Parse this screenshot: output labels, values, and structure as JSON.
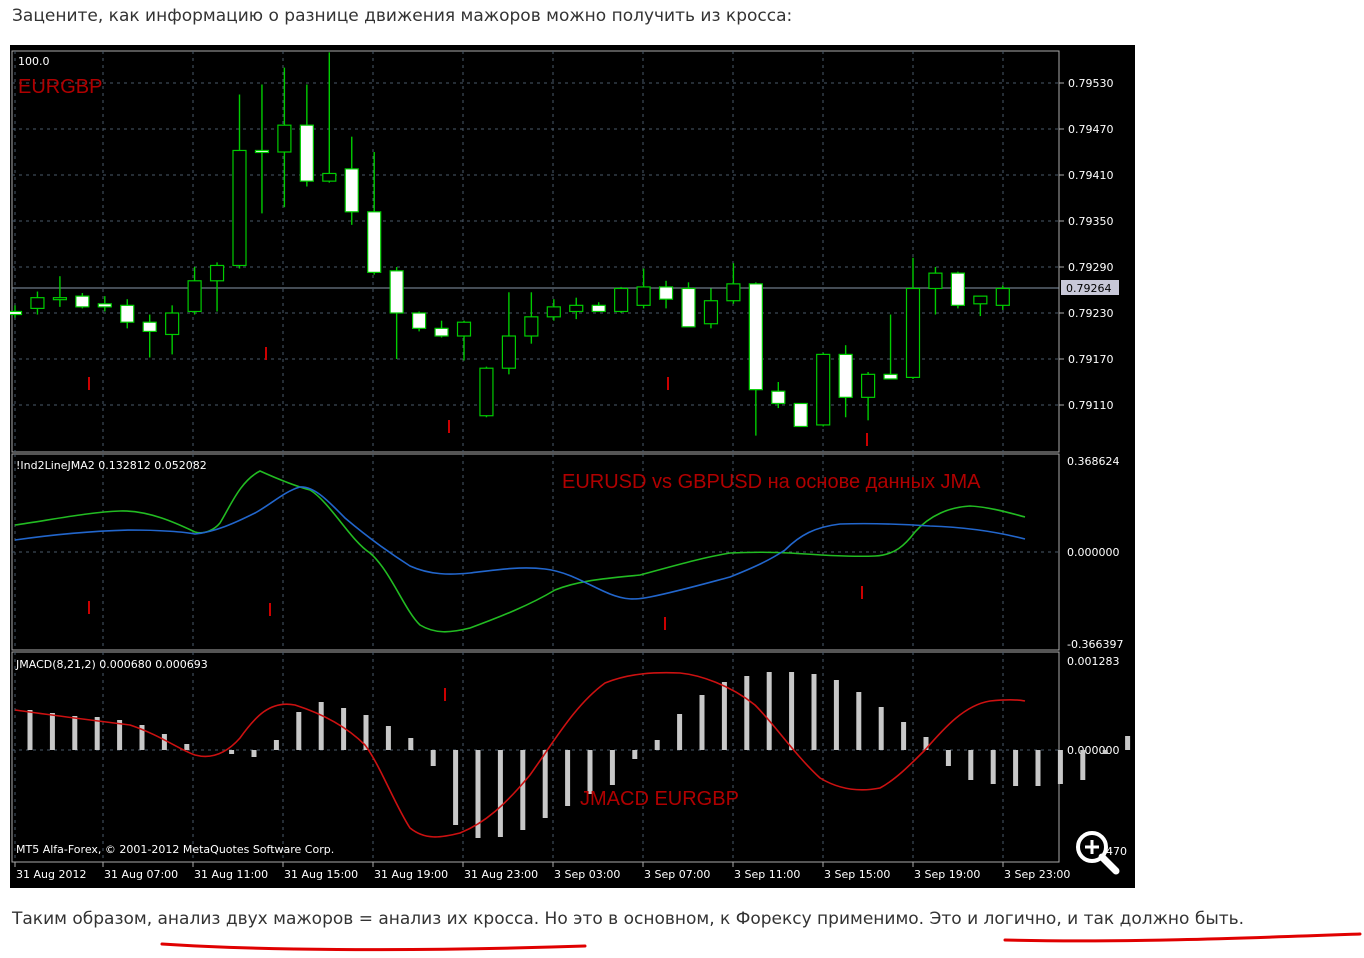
{
  "intro_text": "Зацените, как информацию о разнице движения мажоров можно получить из кросса:",
  "outro": {
    "part1": "Таким образом, ",
    "part2": "анализ двух мажоров = анализ их кросса.",
    "part3": " Но это в основном, к Форексу применимо. ",
    "part4": "Это и логично, и так должно быть."
  },
  "colors": {
    "background": "#000000",
    "grid": "#4a5a6a",
    "bull": "#00cc00",
    "bear_fill": "#ffffff",
    "jma_green": "#22bb22",
    "jma_blue": "#2266cc",
    "signal_red": "#cc0000",
    "histogram": "#c8c8c8",
    "underline": "#e00000"
  },
  "main_panel": {
    "top_label": "100.0",
    "symbol": "EURGBP",
    "price_ticks": [
      "0.79530",
      "0.79470",
      "0.79410",
      "0.79350",
      "0.79290",
      "0.79230",
      "0.79170",
      "0.79110"
    ],
    "price_tick_values": [
      0.7953,
      0.7947,
      0.7941,
      0.7935,
      0.7929,
      0.7923,
      0.7917,
      0.7911
    ],
    "current_price": "0.79264",
    "current_price_value": 0.79264
  },
  "indicator_panel": {
    "title": "!Ind2LineJMA2 0.132812 0.052082",
    "annotation": "EURUSD vs GBPUSD на основе данных JMA",
    "ticks": [
      "0.368624",
      "0.000000",
      "-0.366397"
    ]
  },
  "jmacd_panel": {
    "title": "JMACD(8,21,2) 0.000680 0.000693",
    "annotation": "JMACD EURGBP",
    "ticks": [
      "0.001283",
      "0.000000",
      "470"
    ],
    "copyright": "MT5 Alfa-Forex, © 2001-2012 MetaQuotes Software Corp."
  },
  "time_axis": [
    "31 Aug 2012",
    "31 Aug 07:00",
    "31 Aug 11:00",
    "31 Aug 15:00",
    "31 Aug 19:00",
    "31 Aug 23:00",
    "3 Sep 03:00",
    "3 Sep 07:00",
    "3 Sep 11:00",
    "3 Sep 15:00",
    "3 Sep 19:00",
    "3 Sep 23:00"
  ],
  "zoom_icon": "magnifier-plus-icon",
  "chart_data": {
    "type": "candlestick",
    "title": "EURGBP",
    "candles": [
      {
        "o": 0.79232,
        "h": 0.7924,
        "l": 0.79224,
        "c": 0.79228
      },
      {
        "o": 0.79236,
        "h": 0.79258,
        "l": 0.79228,
        "c": 0.7925
      },
      {
        "o": 0.7925,
        "h": 0.79278,
        "l": 0.79238,
        "c": 0.7925
      },
      {
        "o": 0.79252,
        "h": 0.79256,
        "l": 0.79236,
        "c": 0.79238
      },
      {
        "o": 0.79242,
        "h": 0.79252,
        "l": 0.79232,
        "c": 0.79238
      },
      {
        "o": 0.7924,
        "h": 0.79248,
        "l": 0.7921,
        "c": 0.79218
      },
      {
        "o": 0.79218,
        "h": 0.79228,
        "l": 0.79172,
        "c": 0.79206
      },
      {
        "o": 0.79202,
        "h": 0.7924,
        "l": 0.79176,
        "c": 0.7923
      },
      {
        "o": 0.79232,
        "h": 0.7929,
        "l": 0.79228,
        "c": 0.79272
      },
      {
        "o": 0.79272,
        "h": 0.79296,
        "l": 0.79232,
        "c": 0.79292
      },
      {
        "o": 0.79292,
        "h": 0.79515,
        "l": 0.79288,
        "c": 0.79442
      },
      {
        "o": 0.79442,
        "h": 0.79528,
        "l": 0.7936,
        "c": 0.7944
      },
      {
        "o": 0.7944,
        "h": 0.7955,
        "l": 0.79368,
        "c": 0.79475
      },
      {
        "o": 0.79475,
        "h": 0.79528,
        "l": 0.79395,
        "c": 0.79402
      },
      {
        "o": 0.79402,
        "h": 0.7957,
        "l": 0.794,
        "c": 0.79412
      },
      {
        "o": 0.79418,
        "h": 0.7946,
        "l": 0.79345,
        "c": 0.79362
      },
      {
        "o": 0.79362,
        "h": 0.7944,
        "l": 0.7928,
        "c": 0.79283
      },
      {
        "o": 0.79285,
        "h": 0.7929,
        "l": 0.7917,
        "c": 0.7923
      },
      {
        "o": 0.7923,
        "h": 0.79232,
        "l": 0.79206,
        "c": 0.7921
      },
      {
        "o": 0.7921,
        "h": 0.7922,
        "l": 0.79198,
        "c": 0.792
      },
      {
        "o": 0.792,
        "h": 0.7922,
        "l": 0.79168,
        "c": 0.79218
      },
      {
        "o": 0.79096,
        "h": 0.7916,
        "l": 0.79094,
        "c": 0.79158
      },
      {
        "o": 0.79158,
        "h": 0.79257,
        "l": 0.7915,
        "c": 0.792
      },
      {
        "o": 0.792,
        "h": 0.79257,
        "l": 0.7919,
        "c": 0.79225
      },
      {
        "o": 0.79225,
        "h": 0.79248,
        "l": 0.7922,
        "c": 0.79238
      },
      {
        "o": 0.79232,
        "h": 0.7925,
        "l": 0.79222,
        "c": 0.7924
      },
      {
        "o": 0.7924,
        "h": 0.79244,
        "l": 0.79232,
        "c": 0.79232
      },
      {
        "o": 0.79232,
        "h": 0.79264,
        "l": 0.7923,
        "c": 0.79262
      },
      {
        "o": 0.7924,
        "h": 0.79288,
        "l": 0.79236,
        "c": 0.79264
      },
      {
        "o": 0.79264,
        "h": 0.79272,
        "l": 0.79236,
        "c": 0.79248
      },
      {
        "o": 0.79262,
        "h": 0.7927,
        "l": 0.79216,
        "c": 0.79212
      },
      {
        "o": 0.79216,
        "h": 0.79262,
        "l": 0.7921,
        "c": 0.79246
      },
      {
        "o": 0.79246,
        "h": 0.79295,
        "l": 0.79242,
        "c": 0.79268
      },
      {
        "o": 0.79268,
        "h": 0.7927,
        "l": 0.7907,
        "c": 0.7913
      },
      {
        "o": 0.79128,
        "h": 0.7914,
        "l": 0.79106,
        "c": 0.79112
      },
      {
        "o": 0.79112,
        "h": 0.79112,
        "l": 0.79084,
        "c": 0.79082
      },
      {
        "o": 0.79084,
        "h": 0.79178,
        "l": 0.79082,
        "c": 0.79176
      },
      {
        "o": 0.79176,
        "h": 0.79188,
        "l": 0.79094,
        "c": 0.7912
      },
      {
        "o": 0.7912,
        "h": 0.79153,
        "l": 0.7909,
        "c": 0.7915
      },
      {
        "o": 0.7915,
        "h": 0.79228,
        "l": 0.79144,
        "c": 0.79144
      },
      {
        "o": 0.79146,
        "h": 0.79302,
        "l": 0.79144,
        "c": 0.79262
      },
      {
        "o": 0.79262,
        "h": 0.7929,
        "l": 0.79228,
        "c": 0.79282
      },
      {
        "o": 0.79282,
        "h": 0.79284,
        "l": 0.79236,
        "c": 0.7924
      },
      {
        "o": 0.79242,
        "h": 0.7925,
        "l": 0.79226,
        "c": 0.79252
      },
      {
        "o": 0.7924,
        "h": 0.79266,
        "l": 0.79234,
        "c": 0.79262
      }
    ]
  }
}
